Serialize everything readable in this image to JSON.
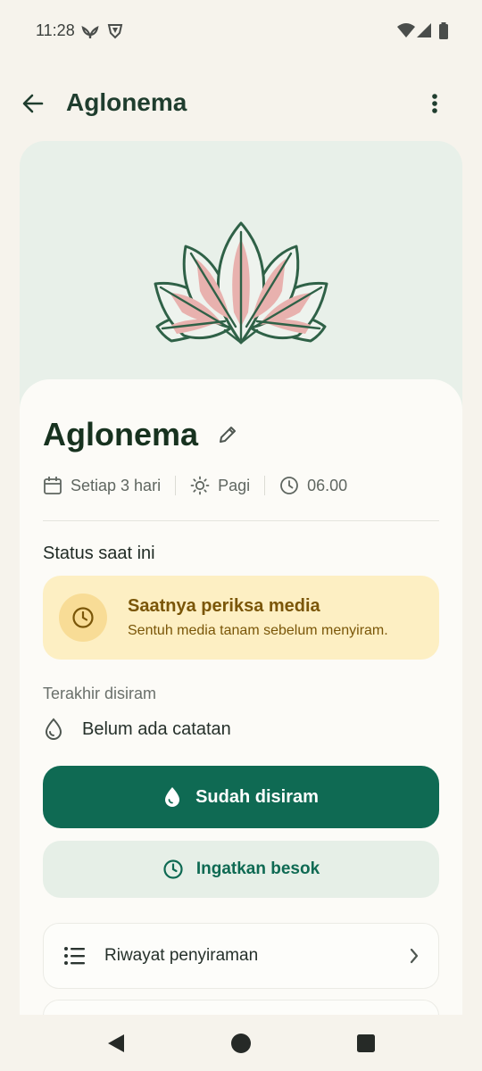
{
  "status_bar": {
    "time": "11:28",
    "icons": [
      "leaf-icon",
      "shield-icon",
      "wifi-icon",
      "signal-icon",
      "battery-icon"
    ]
  },
  "app_bar": {
    "title": "Aglonema",
    "back_icon": "arrow-back-icon",
    "more_icon": "more-vert-icon"
  },
  "plant": {
    "name": "Aglonema",
    "schedule": {
      "frequency": "Setiap 3 hari",
      "time_of_day": "Pagi",
      "time": "06.00"
    }
  },
  "status": {
    "section_title": "Status saat ini",
    "card_title": "Saatnya periksa media",
    "card_subtitle": "Sentuh media tanam sebelum menyiram."
  },
  "last_watered": {
    "label": "Terakhir disiram",
    "value": "Belum ada catatan"
  },
  "actions": {
    "primary_label": "Sudah disiram",
    "secondary_label": "Ingatkan besok"
  },
  "list": {
    "history_label": "Riwayat penyiraman"
  },
  "colors": {
    "primary": "#0f6a53",
    "primary_text": "#ffffff",
    "secondary_bg": "#e6efe7",
    "warning_bg": "#fdefc3",
    "warning_text": "#7a5608",
    "hero_bg": "#e8f0e9",
    "screen_bg": "#f6f3ec",
    "leaf_outline": "#2f6147",
    "leaf_pink": "#e8b1ae"
  }
}
